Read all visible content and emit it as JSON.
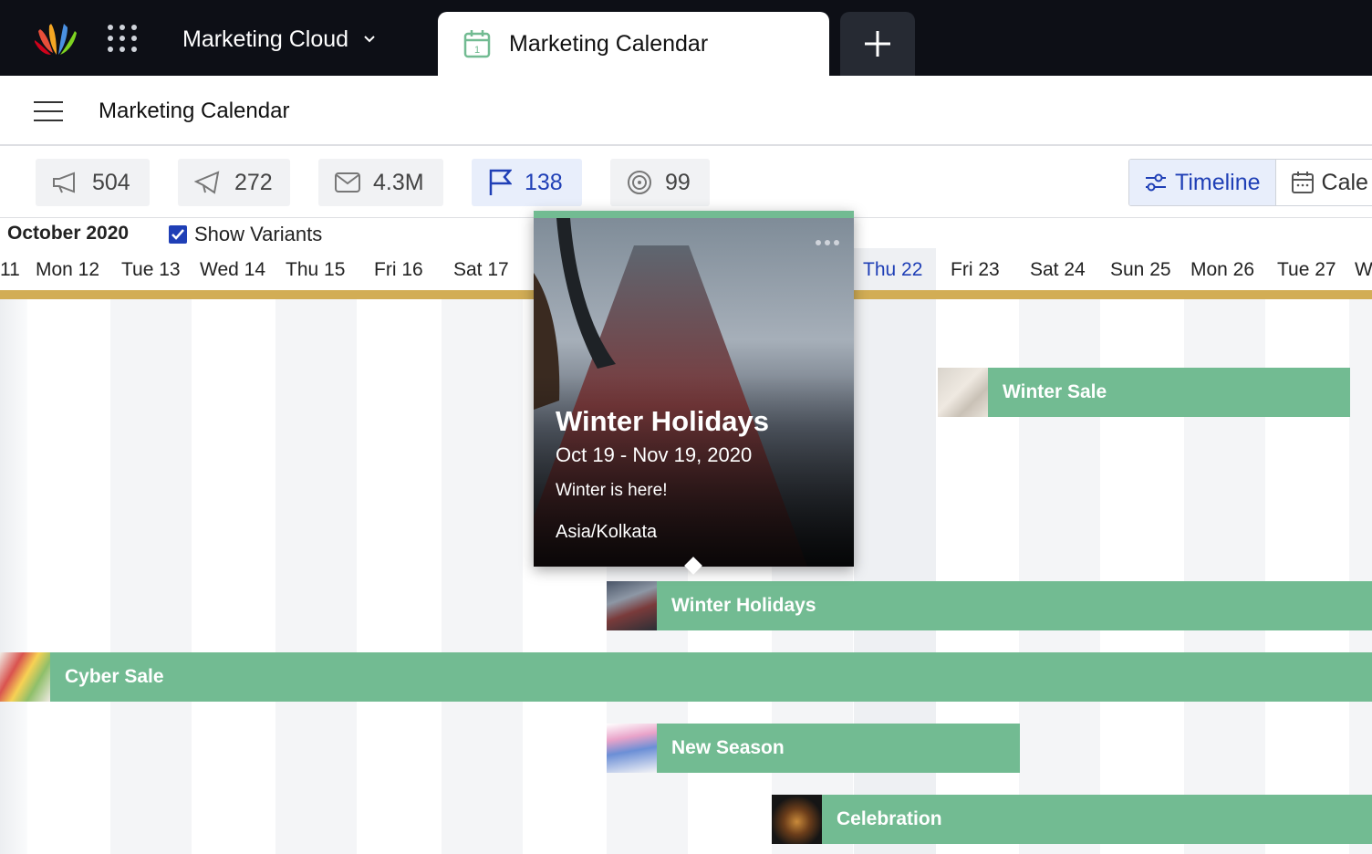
{
  "topbar": {
    "app_name": "Marketing Cloud",
    "active_tab": "Marketing Calendar",
    "add_tab_icon": "plus-icon",
    "logo_icon": "sprinklr-logo",
    "apps_icon": "app-grid-icon"
  },
  "page": {
    "title": "Marketing Calendar",
    "menu_icon": "hamburger-menu-icon"
  },
  "stats": [
    {
      "icon": "megaphone-icon",
      "value": "504"
    },
    {
      "icon": "megaphone-outline-icon",
      "value": "272"
    },
    {
      "icon": "envelope-icon",
      "value": "4.3M"
    },
    {
      "icon": "flag-icon",
      "value": "138"
    },
    {
      "icon": "target-icon",
      "value": "99"
    }
  ],
  "view_toggle": {
    "timeline": "Timeline",
    "calendar": "Cale"
  },
  "calendar": {
    "month": "October 2020",
    "show_variants_label": "Show Variants",
    "show_variants_checked": true,
    "days": [
      "11",
      "Mon 12",
      "Tue 13",
      "Wed 14",
      "Thu 15",
      "Fri 16",
      "Sat 17",
      "Thu 22",
      "Fri 23",
      "Sat 24",
      "Sun 25",
      "Mon 26",
      "Tue 27",
      "W"
    ],
    "today": "Thu 22"
  },
  "events": [
    {
      "name": "Winter Sale"
    },
    {
      "name": "Winter Holidays"
    },
    {
      "name": "Cyber Sale"
    },
    {
      "name": "New Season"
    },
    {
      "name": "Celebration"
    }
  ],
  "popover": {
    "title": "Winter Holidays",
    "dates": "Oct 19 - Nov 19, 2020",
    "description": "Winter is here!",
    "timezone": "Asia/Kolkata"
  },
  "colors": {
    "event_green": "#72bb92",
    "accent_blue": "#1f3fb6",
    "timeline_gold": "#d2ad55",
    "topbar_bg": "#0d0f16"
  }
}
